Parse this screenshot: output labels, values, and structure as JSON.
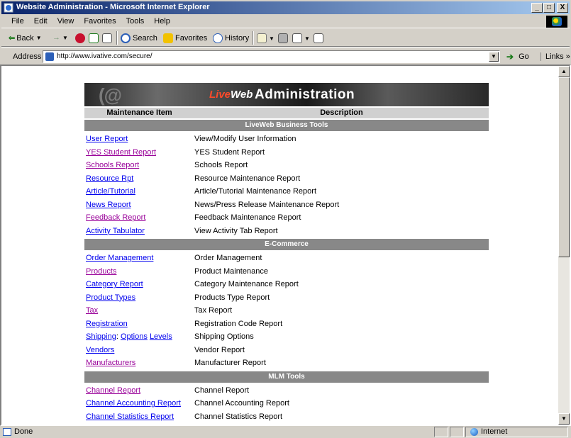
{
  "window": {
    "title": "Website Administration - Microsoft Internet Explorer",
    "minimize": "_",
    "maximize": "□",
    "close": "X"
  },
  "menu": [
    "File",
    "Edit",
    "View",
    "Favorites",
    "Tools",
    "Help"
  ],
  "toolbar": {
    "back": "Back",
    "forward": "→",
    "search": "Search",
    "favorites": "Favorites",
    "history": "History"
  },
  "address": {
    "label": "Address",
    "url": "http://www.ivative.com/secure/",
    "go": "Go",
    "links": "Links »"
  },
  "admin": {
    "brand": "Live",
    "brand2": "Web",
    "title": "Administration",
    "col_item": "Maintenance Item",
    "col_desc": "Description",
    "sections": [
      {
        "name": "LiveWeb Business Tools",
        "rows": [
          {
            "item": "User Report",
            "desc": "View/Modify User Information",
            "visited": false
          },
          {
            "item": "YES Student Report",
            "desc": "YES Student Report",
            "visited": true
          },
          {
            "item": "Schools Report",
            "desc": "Schools Report",
            "visited": true
          },
          {
            "item": "Resource Rpt",
            "desc": "Resource Maintenance Report",
            "visited": false
          },
          {
            "item": "Article/Tutorial",
            "desc": "Article/Tutorial Maintenance Report",
            "visited": false
          },
          {
            "item": "News Report",
            "desc": "News/Press Release Maintenance Report",
            "visited": false
          },
          {
            "item": "Feedback Report",
            "desc": "Feedback Maintenance Report",
            "visited": true
          },
          {
            "item": "Activity Tabulator",
            "desc": "View Activity Tab Report",
            "visited": false
          }
        ]
      },
      {
        "name": "E-Commerce",
        "rows": [
          {
            "item": "Order Management",
            "desc": "Order Management",
            "visited": false
          },
          {
            "item": "Products",
            "desc": "Product Maintenance",
            "visited": true
          },
          {
            "item": "Category Report",
            "desc": "Category Maintenance Report",
            "visited": false
          },
          {
            "item": "Product Types",
            "desc": "Products Type Report",
            "visited": false
          },
          {
            "item": "Tax",
            "desc": "Tax Report",
            "visited": true
          },
          {
            "item": "Registration",
            "desc": "Registration Code Report",
            "visited": false
          },
          {
            "item": "Shipping",
            "item2": "Options",
            "item3": "Levels",
            "desc": "Shipping Options",
            "visited": false
          },
          {
            "item": "Vendors",
            "desc": "Vendor Report",
            "visited": false
          },
          {
            "item": "Manufacturers",
            "desc": "Manufacturer Report",
            "visited": true
          }
        ]
      },
      {
        "name": "MLM Tools",
        "rows": [
          {
            "item": "Channel Report",
            "desc": "Channel Report",
            "visited": true
          },
          {
            "item": "Channel Accounting Report",
            "desc": "Channel Accounting Report",
            "visited": false
          },
          {
            "item": "Channel Statistics Report",
            "desc": "Channel Statistics Report",
            "visited": false
          }
        ]
      }
    ]
  },
  "status": {
    "text": "Done",
    "zone": "Internet"
  }
}
